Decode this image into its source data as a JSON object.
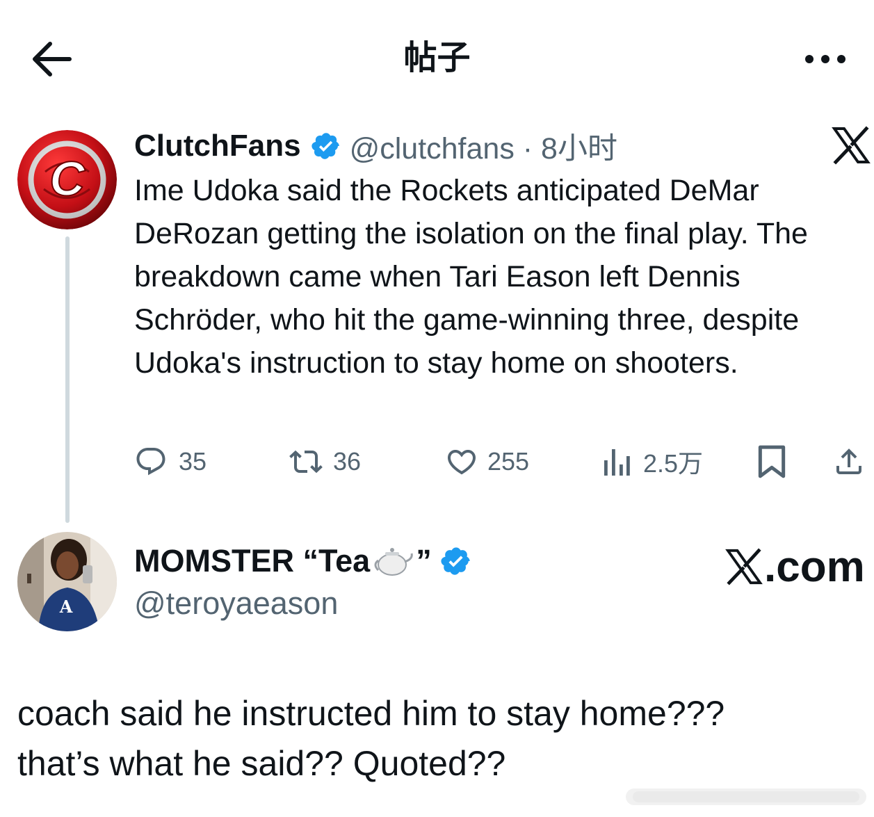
{
  "header": {
    "title": "帖子",
    "back_icon": "arrow-left-icon",
    "more_icon": "more-horizontal-icon"
  },
  "tweet": {
    "author_name": "ClutchFans",
    "handle_time": "@clutchfans · 8小时",
    "text": "Ime Udoka said the Rockets anticipated DeMar DeRozan getting the isolation on the final play. The breakdown came when Tari Eason left Dennis Schröder, who hit the game-winning three, despite Udoka's instruction to stay home on shooters.",
    "avatar_letter": "C",
    "actions": {
      "replies": "35",
      "retweets": "36",
      "likes": "255",
      "views": "2.5万"
    }
  },
  "quote": {
    "author_name": "MOMSTER “Tea",
    "author_name_end": "”",
    "handle": "@teroyaeason",
    "site_label": ".com",
    "comment_line1": "coach said he instructed him to stay home???",
    "comment_line2": "that’s what he said?? Quoted??"
  },
  "colors": {
    "text": "#0f1419",
    "secondary": "#536471",
    "verified": "#1d9bf0",
    "thread_line": "#cfd9de",
    "brand_red": "#d0121b"
  }
}
